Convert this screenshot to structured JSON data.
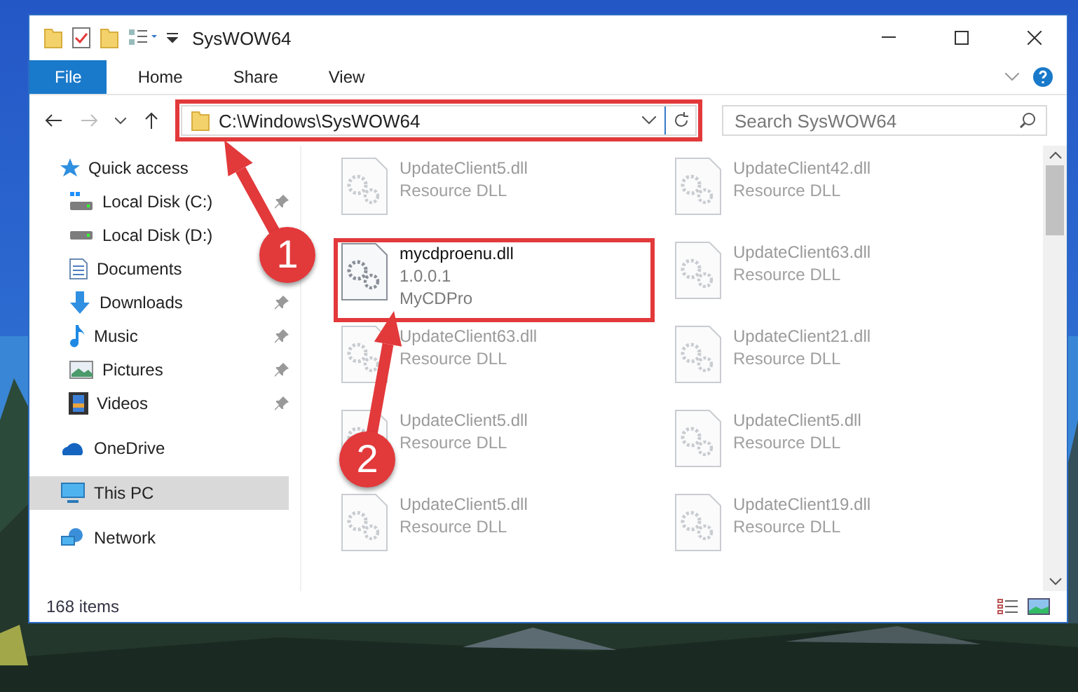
{
  "window": {
    "title": "SysWOW64"
  },
  "ribbon_tabs": [
    {
      "label": "File",
      "selected": true
    },
    {
      "label": "Home",
      "selected": false
    },
    {
      "label": "Share",
      "selected": false
    },
    {
      "label": "View",
      "selected": false
    }
  ],
  "address": {
    "path": "C:\\Windows\\SysWOW64"
  },
  "search": {
    "placeholder": "Search SysWOW64"
  },
  "sidebar": {
    "items": [
      {
        "label": "Quick access",
        "selected": false,
        "children": [
          {
            "label": "Local Disk (C:)",
            "pinned": true
          },
          {
            "label": "Local Disk (D:)",
            "pinned": false
          },
          {
            "label": "Documents",
            "pinned": false
          },
          {
            "label": "Downloads",
            "pinned": true
          },
          {
            "label": "Music",
            "pinned": true
          },
          {
            "label": "Pictures",
            "pinned": true
          },
          {
            "label": "Videos",
            "pinned": true
          }
        ]
      },
      {
        "label": "OneDrive",
        "selected": false
      },
      {
        "label": "This PC",
        "selected": true
      },
      {
        "label": "Network",
        "selected": false
      }
    ]
  },
  "files": [
    {
      "name": "UpdateClient5.dll",
      "line_2": "Resource DLL",
      "blurred": true
    },
    {
      "name": "UpdateClient42.dll",
      "line_2": "Resource DLL",
      "blurred": true
    },
    {
      "name": "mycdproenu.dll",
      "line_2": "1.0.0.1",
      "line_3": "MyCDPro",
      "blurred": false
    },
    {
      "name": "UpdateClient63.dll",
      "line_2": "Resource DLL",
      "blurred": true
    },
    {
      "name": "UpdateClient63.dll",
      "line_2": "Resource DLL",
      "blurred": true
    },
    {
      "name": "UpdateClient21.dll",
      "line_2": "Resource DLL",
      "blurred": true
    },
    {
      "name": "UpdateClient5.dll",
      "line_2": "Resource DLL",
      "blurred": true
    },
    {
      "name": "UpdateClient5.dll",
      "line_2": "Resource DLL",
      "blurred": true
    },
    {
      "name": "UpdateClient5.dll",
      "line_2": "Resource DLL",
      "blurred": true
    },
    {
      "name": "UpdateClient19.dll",
      "line_2": "Resource DLL",
      "blurred": true
    }
  ],
  "status_bar": {
    "item_count": "168 items"
  },
  "annotations": [
    {
      "number": "1"
    },
    {
      "number": "2"
    }
  ]
}
